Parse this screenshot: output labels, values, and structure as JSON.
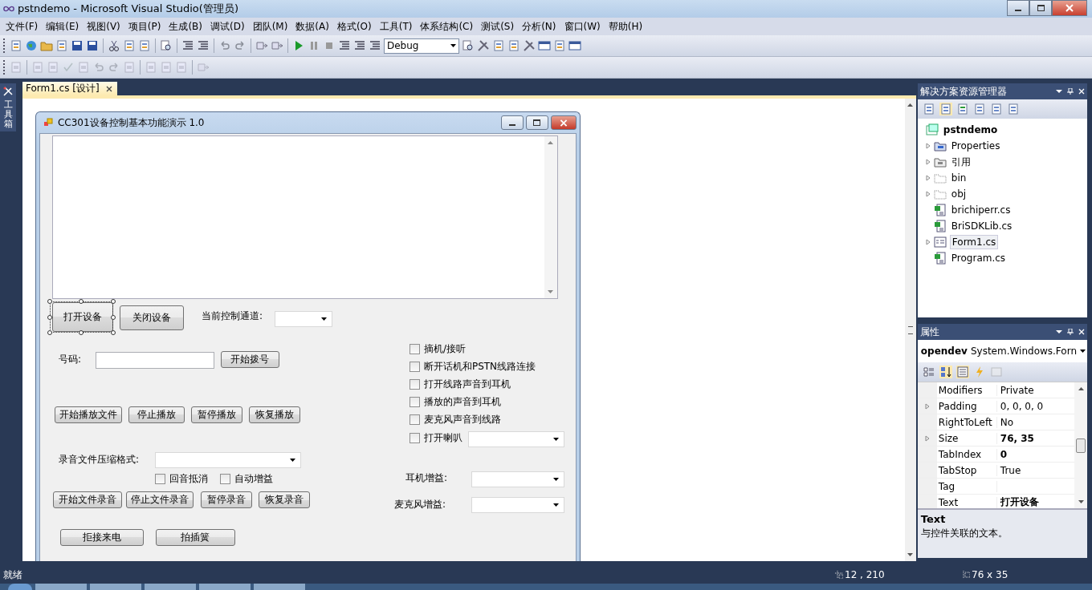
{
  "window": {
    "title": "pstndemo - Microsoft Visual Studio(管理员)"
  },
  "menu": [
    "文件(F)",
    "编辑(E)",
    "视图(V)",
    "项目(P)",
    "生成(B)",
    "调试(D)",
    "团队(M)",
    "数据(A)",
    "格式(O)",
    "工具(T)",
    "体系结构(C)",
    "测试(S)",
    "分析(N)",
    "窗口(W)",
    "帮助(H)"
  ],
  "toolbar": {
    "configuration": "Debug"
  },
  "toolbox_tab": "工具箱",
  "document_tabs": [
    {
      "label": "Form1.cs [设计]",
      "selected": true
    }
  ],
  "form": {
    "title": "CC301设备控制基本功能演示 1.0",
    "controls": [
      {
        "kind": "textarea",
        "selected": false
      },
      {
        "kind": "button",
        "label": "打开设备",
        "selected": true
      },
      {
        "kind": "button",
        "label": "关闭设备",
        "selected": false
      },
      {
        "kind": "label",
        "label": "当前控制通道:",
        "selected": false
      },
      {
        "kind": "combobox",
        "selected": false
      },
      {
        "kind": "label",
        "label": "号码:",
        "selected": false
      },
      {
        "kind": "textbox",
        "selected": false
      },
      {
        "kind": "button",
        "label": "开始拨号",
        "selected": false
      },
      {
        "kind": "button",
        "label": "开始播放文件",
        "selected": false
      },
      {
        "kind": "button",
        "label": "停止播放",
        "selected": false
      },
      {
        "kind": "button",
        "label": "暂停播放",
        "selected": false
      },
      {
        "kind": "button",
        "label": "恢复播放",
        "selected": false
      },
      {
        "kind": "label",
        "label": "录音文件压缩格式:",
        "selected": false
      },
      {
        "kind": "combobox",
        "selected": false
      },
      {
        "kind": "checkbox",
        "label": "回音抵消",
        "checked": false,
        "selected": false
      },
      {
        "kind": "checkbox",
        "label": "自动增益",
        "checked": false,
        "selected": false
      },
      {
        "kind": "button",
        "label": "开始文件录音",
        "selected": false
      },
      {
        "kind": "button",
        "label": "停止文件录音",
        "selected": false
      },
      {
        "kind": "button",
        "label": "暂停录音",
        "selected": false
      },
      {
        "kind": "button",
        "label": "恢复录音",
        "selected": false
      },
      {
        "kind": "button",
        "label": "拒接来电",
        "selected": false
      },
      {
        "kind": "button",
        "label": "拍插簧",
        "selected": false
      },
      {
        "kind": "checkbox",
        "label": "摘机/接听",
        "checked": false,
        "selected": false
      },
      {
        "kind": "checkbox",
        "label": "断开话机和PSTN线路连接",
        "checked": false,
        "selected": false
      },
      {
        "kind": "checkbox",
        "label": "打开线路声音到耳机",
        "checked": false,
        "selected": false
      },
      {
        "kind": "checkbox",
        "label": "播放的声音到耳机",
        "checked": false,
        "selected": false
      },
      {
        "kind": "checkbox",
        "label": "麦克风声音到线路",
        "checked": false,
        "selected": false
      },
      {
        "kind": "checkbox",
        "label": "打开喇叭",
        "checked": false,
        "selected": false
      },
      {
        "kind": "combobox",
        "selected": false
      },
      {
        "kind": "label",
        "label": "耳机增益:",
        "selected": false
      },
      {
        "kind": "combobox",
        "selected": false
      },
      {
        "kind": "label",
        "label": "麦克风增益:",
        "selected": false
      },
      {
        "kind": "combobox",
        "selected": false
      }
    ]
  },
  "solution_explorer": {
    "title": "解决方案资源管理器",
    "root": {
      "label": "pstndemo",
      "children": [
        {
          "label": "Properties",
          "kind": "properties",
          "expandable": true,
          "selected": false
        },
        {
          "label": "引用",
          "kind": "references",
          "expandable": true,
          "selected": false
        },
        {
          "label": "bin",
          "kind": "folder",
          "expandable": true,
          "selected": false
        },
        {
          "label": "obj",
          "kind": "folder",
          "expandable": true,
          "selected": false
        },
        {
          "label": "brichiperr.cs",
          "kind": "code",
          "expandable": false,
          "selected": false
        },
        {
          "label": "BriSDKLib.cs",
          "kind": "code",
          "expandable": false,
          "selected": false
        },
        {
          "label": "Form1.cs",
          "kind": "form",
          "expandable": true,
          "selected": true
        },
        {
          "label": "Program.cs",
          "kind": "code",
          "expandable": false,
          "selected": false
        }
      ]
    }
  },
  "properties": {
    "title": "属性",
    "object_name": "opendev",
    "object_type": "System.Windows.Forn",
    "rows": [
      {
        "name": "Modifiers",
        "value": "Private",
        "expandable": false,
        "bold": false
      },
      {
        "name": "Padding",
        "value": "0, 0, 0, 0",
        "expandable": true,
        "bold": false
      },
      {
        "name": "RightToLeft",
        "value": "No",
        "expandable": false,
        "bold": false
      },
      {
        "name": "Size",
        "value": "76, 35",
        "expandable": true,
        "bold": true
      },
      {
        "name": "TabIndex",
        "value": "0",
        "expandable": false,
        "bold": true
      },
      {
        "name": "TabStop",
        "value": "True",
        "expandable": false,
        "bold": false
      },
      {
        "name": "Tag",
        "expandable": false
      },
      {
        "name": "Text",
        "value": "打开设备",
        "expandable": false,
        "bold": true
      }
    ],
    "description_title": "Text",
    "description": "与控件关联的文本。"
  },
  "status_bar": {
    "message": "就绪",
    "position": "12 , 210",
    "size": "76 x 35"
  }
}
